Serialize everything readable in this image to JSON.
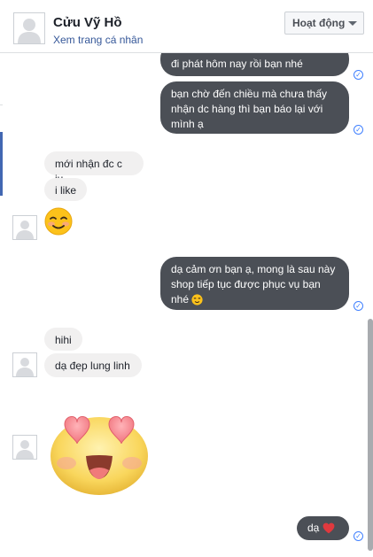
{
  "header": {
    "contact_name": "Cửu Vỹ Hồ",
    "profile_link": "Xem trang cá nhân",
    "status_label": "Hoạt động"
  },
  "messages": {
    "out_1": "đi phát hôm nay rồi bạn nhé",
    "out_2_line1": "bạn chờ đến chiều mà chưa thấy",
    "out_2_line2": "nhận dc hàng thì bạn báo lại với",
    "out_2_line3": "mình ạ",
    "in_1": "mới nhận đc c iu",
    "in_2": "i like",
    "out_3_line1": "dạ cảm ơn bạn ạ, mong là sau này",
    "out_3_line2": "shop tiếp tục được phục vụ bạn",
    "out_3_line3": "nhé",
    "in_3": "hihi",
    "in_4": "dạ đẹp lung linh",
    "out_4": "dạ"
  },
  "icons": {
    "seen": "check-circle-icon",
    "smile": "smiling-face-icon",
    "heart_eyes": "heart-eyes-emoji-icon",
    "heart": "heart-icon",
    "dropdown": "chevron-down-icon"
  },
  "colors": {
    "out_bubble": "#4b4f56",
    "in_bubble": "#f1f0f0",
    "link": "#365899",
    "seen": "#4080ff",
    "heart": "#e0393e"
  }
}
